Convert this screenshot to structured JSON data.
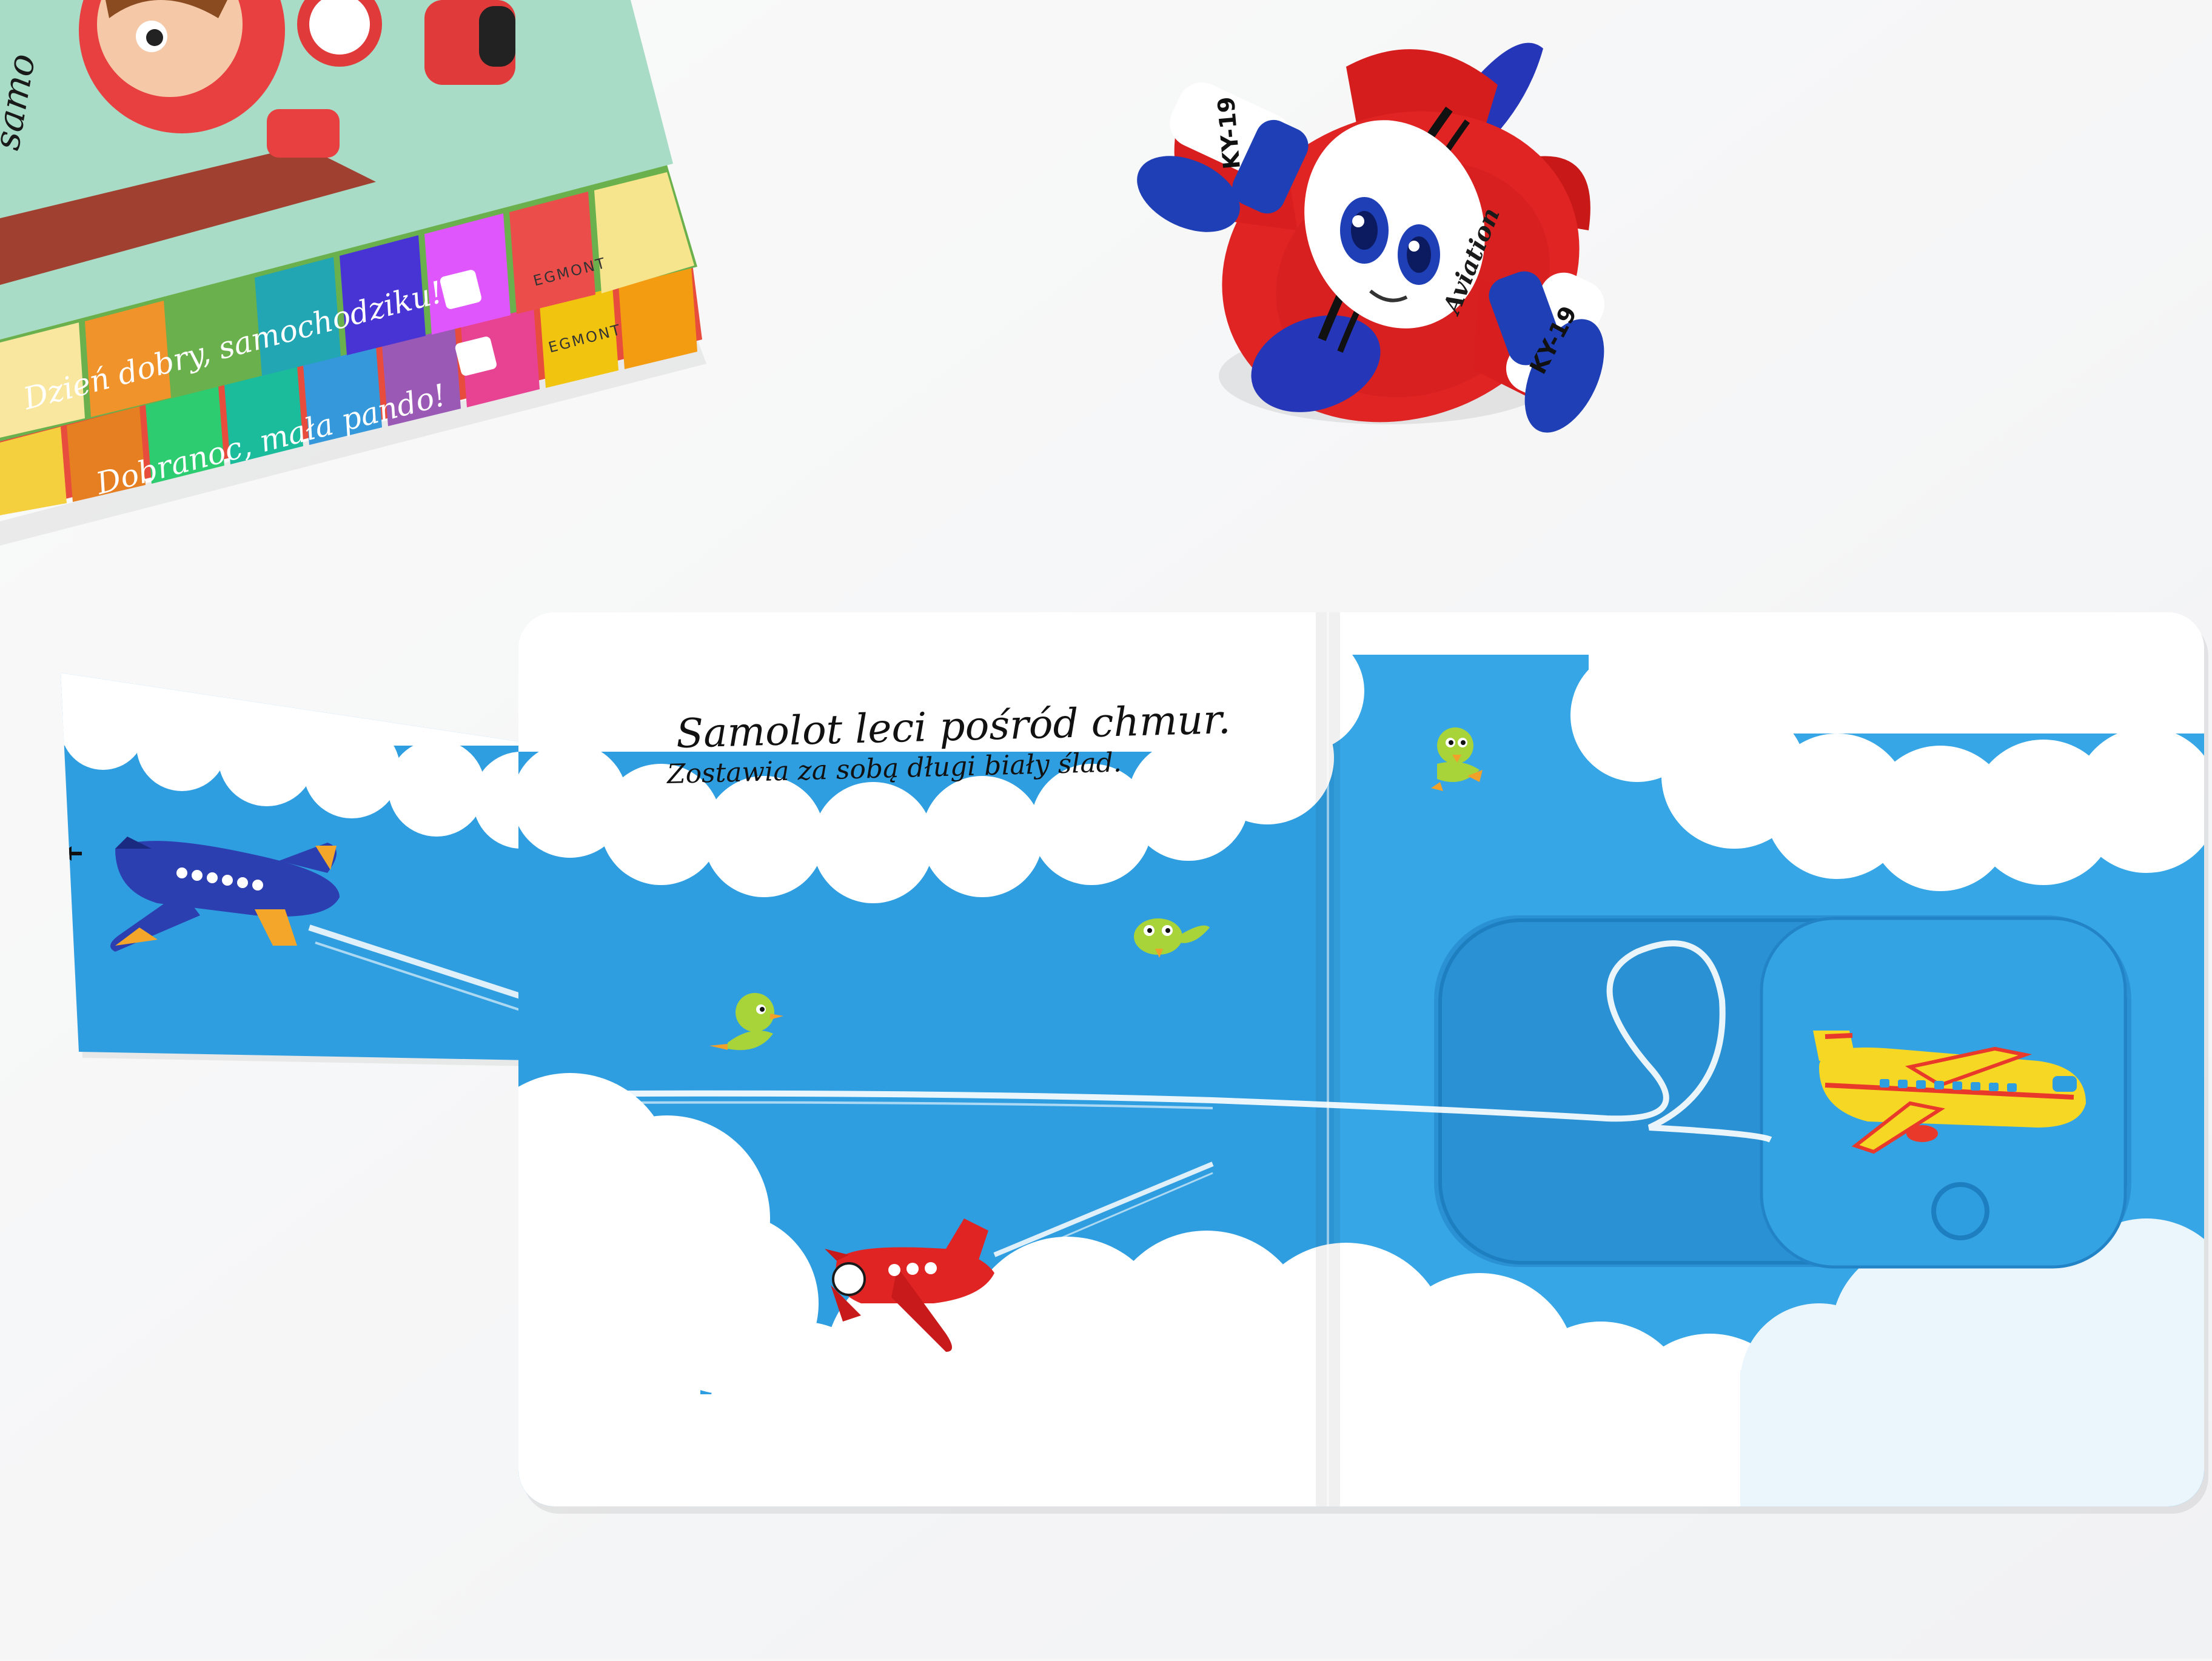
{
  "book": {
    "text_line_1": "Samolot leci pośród chmur.",
    "text_line_2": "Zostawia za sobą długi biały ślad."
  },
  "books_stack": {
    "spine_1": "Dzień dobry, samochodziku!",
    "spine_2": "Dobranoc, mała pando!",
    "publisher_1": "EGMONT",
    "publisher_2": "EGMONT",
    "cover_partial_title": "samo"
  },
  "toy_airplane": {
    "wing_code_left": "KY-19",
    "wing_code_right": "KY-19",
    "brand": "Aviation"
  },
  "colors": {
    "sky": "#2f9ee0",
    "cloud": "#ffffff",
    "toy_red": "#d81e1e",
    "toy_blue": "#1f3fb6",
    "plane_yellow": "#f6d824",
    "plane_blue": "#2c3fb0"
  }
}
